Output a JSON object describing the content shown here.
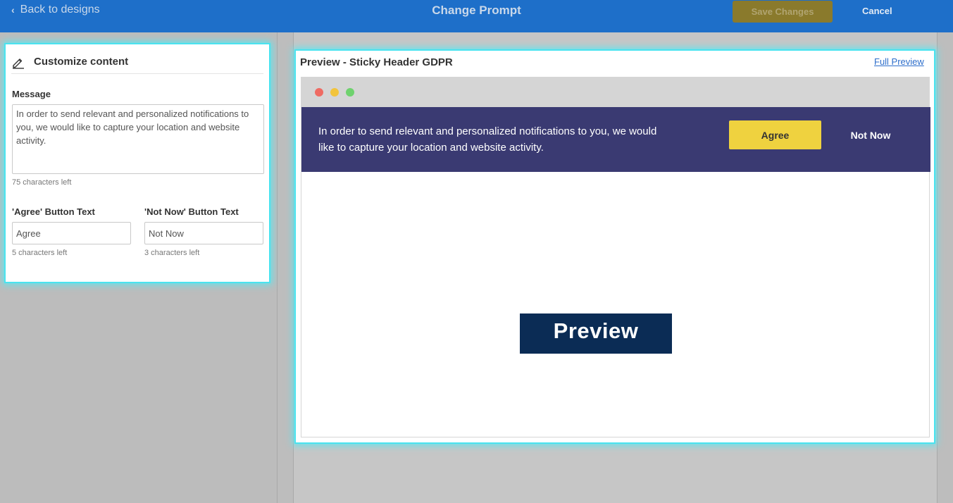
{
  "topbar": {
    "back_label": "Back to designs",
    "title": "Change Prompt",
    "save_label": "Save Changes",
    "cancel_label": "Cancel"
  },
  "customize": {
    "heading": "Customize content",
    "message_label": "Message",
    "message_value": "In order to send relevant and personalized notifications to you, we would like to capture your location and website activity.",
    "message_hint": "75 characters left",
    "agree_label": "'Agree' Button Text",
    "agree_value": "Agree",
    "agree_hint": "5 characters left",
    "notnow_label": "'Not Now' Button Text",
    "notnow_value": "Not Now",
    "notnow_hint": "3 characters left"
  },
  "preview": {
    "title": "Preview - Sticky Header GDPR",
    "full_preview_link": "Full Preview",
    "banner_message": "In order to send relevant and personalized notifications to you, we would like to capture your location and website activity.",
    "agree_button": "Agree",
    "notnow_button": "Not Now",
    "badge": "Preview"
  },
  "colors": {
    "topbar": "#1e6fc9",
    "banner": "#3a3a72",
    "agree": "#efd23f",
    "highlight": "#4ae3ef",
    "badge": "#0b2c55"
  },
  "icons": {
    "back": "chevron-left-icon",
    "customize": "pencil-icon",
    "window_dots": [
      "close-dot",
      "minimize-dot",
      "maximize-dot"
    ]
  }
}
